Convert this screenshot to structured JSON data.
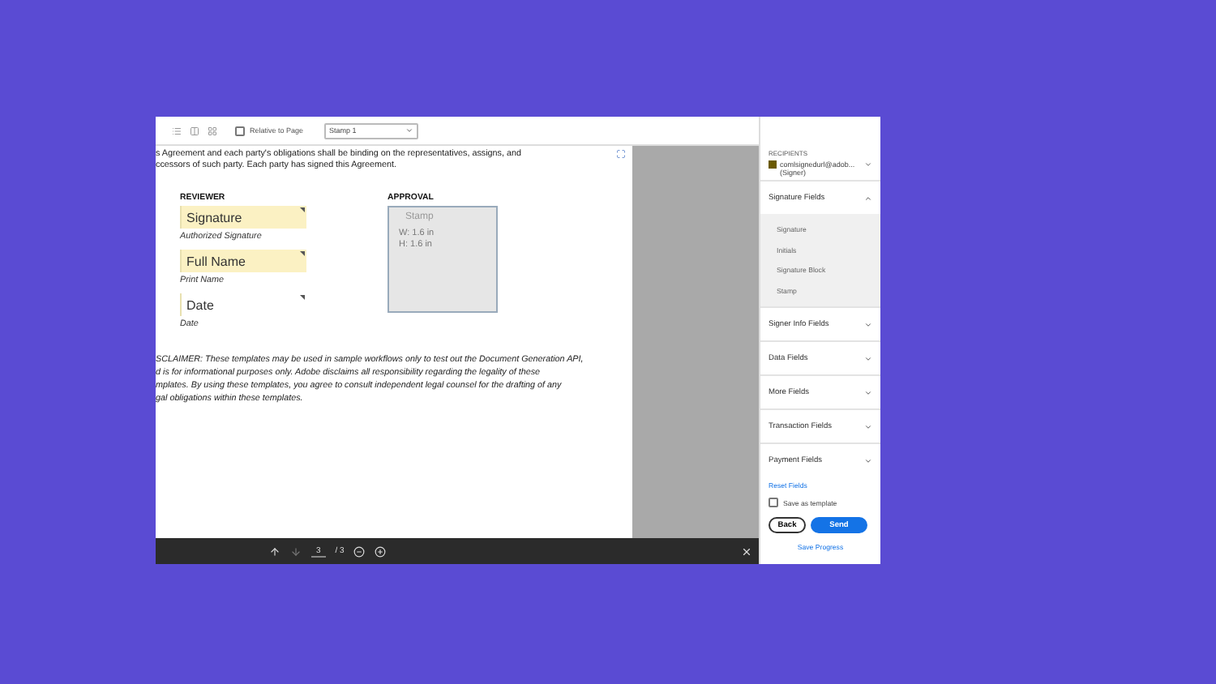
{
  "toolbar": {
    "relative_to_page": {
      "label": "Relative to Page",
      "checked": false
    },
    "dropdown": {
      "value": "Stamp 1"
    }
  },
  "document": {
    "intro": [
      "s Agreement and each party's obligations shall be binding on the representatives, assigns, and",
      "ccessors of such party. Each party has signed this Agreement."
    ],
    "reviewer": {
      "heading": "REVIEWER",
      "fields": [
        {
          "value": "Signature",
          "caption": "Authorized Signature",
          "kind": "filled"
        },
        {
          "value": "Full Name",
          "caption": "Print Name",
          "kind": "filled"
        },
        {
          "value": "Date",
          "caption": "Date",
          "kind": "plain"
        }
      ]
    },
    "approval": {
      "heading": "APPROVAL",
      "stamp": {
        "label": "Stamp",
        "width": "W: 1.6 in",
        "height": "H: 1.6 in"
      }
    },
    "disclaimer": [
      "SCLAIMER: These templates may be used in sample workflows only to test out the Document Generation API,",
      "d is for informational purposes only.  Adobe disclaims all responsibility regarding the legality of these",
      "mplates.  By using these templates, you agree to consult independent legal counsel for the drafting of any",
      "gal obligations within these templates."
    ]
  },
  "pager": {
    "page": "3",
    "total": "/ 3"
  },
  "sidebar": {
    "recipients_label": "RECIPIENTS",
    "recipient": {
      "email": "comlsignedurl@adob...",
      "role": "(Signer)",
      "color": "#6b5a00"
    },
    "sections": [
      {
        "title": "Signature Fields",
        "expanded": true,
        "items": [
          "Signature",
          "Initials",
          "Signature Block",
          "Stamp"
        ]
      },
      {
        "title": "Signer Info Fields",
        "expanded": false
      },
      {
        "title": "Data Fields",
        "expanded": false
      },
      {
        "title": "More Fields",
        "expanded": false
      },
      {
        "title": "Transaction Fields",
        "expanded": false
      },
      {
        "title": "Payment Fields",
        "expanded": false
      }
    ],
    "reset": "Reset Fields",
    "save_template": {
      "label": "Save as template",
      "checked": false
    },
    "back": "Back",
    "send": "Send",
    "save_progress": "Save Progress"
  }
}
